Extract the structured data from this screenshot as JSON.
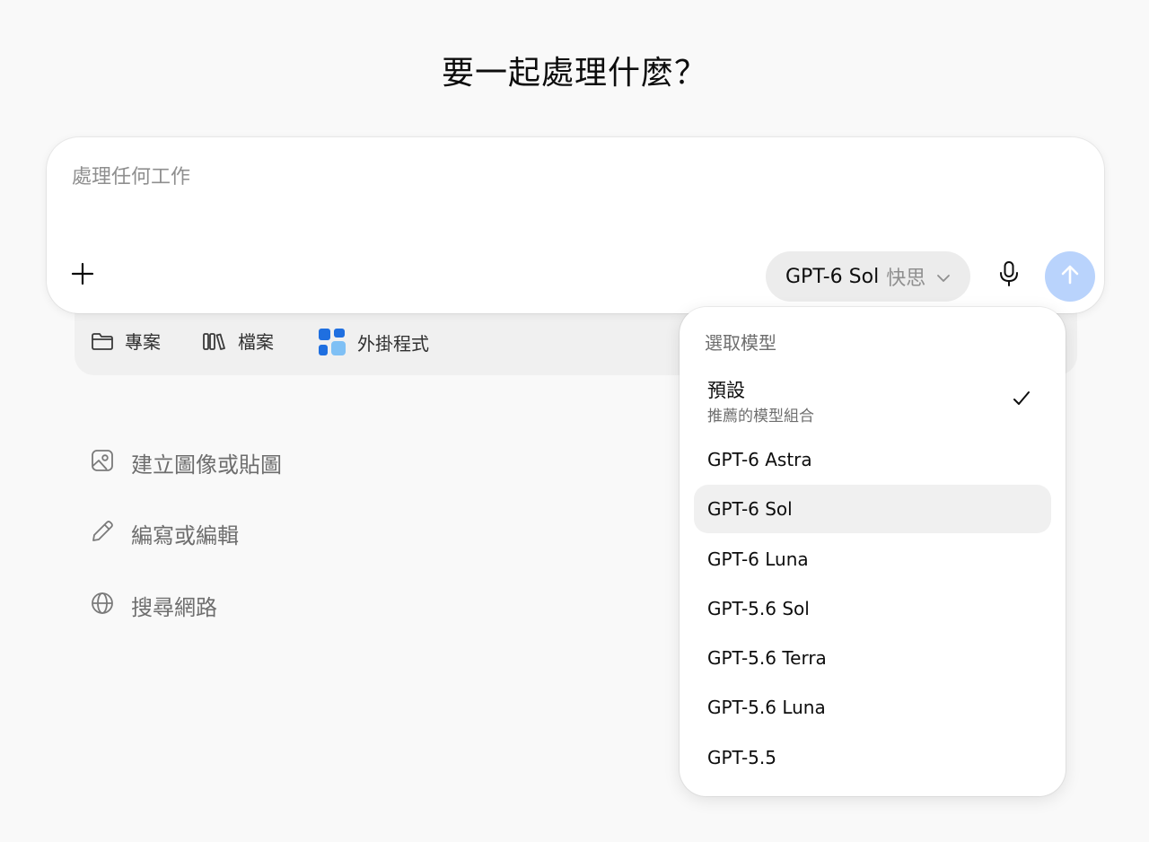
{
  "heading": "要一起處理什麼？",
  "composer": {
    "placeholder": "處理任何工作",
    "model_name": "GPT-6 Sol",
    "model_mode": "快思",
    "send_color": "#b9d3fc"
  },
  "tray": {
    "items": [
      {
        "label": "專案",
        "icon": "folder-icon"
      },
      {
        "label": "檔案",
        "icon": "library-icon"
      },
      {
        "label": "外掛程式",
        "icon": "apps-grid-icon"
      }
    ]
  },
  "suggestions": [
    {
      "label": "建立圖像或貼圖",
      "icon": "image-icon"
    },
    {
      "label": "編寫或編輯",
      "icon": "pencil-icon"
    },
    {
      "label": "搜尋網路",
      "icon": "globe-icon"
    }
  ],
  "model_menu": {
    "heading": "選取模型",
    "default": {
      "title": "預設",
      "subtitle": "推薦的模型組合",
      "checked": true
    },
    "options": [
      "GPT-6 Astra",
      "GPT-6 Sol",
      "GPT-6 Luna",
      "GPT-5.6 Sol",
      "GPT-5.6 Terra",
      "GPT-5.6 Luna",
      "GPT-5.5"
    ],
    "highlighted": "GPT-6 Sol"
  }
}
